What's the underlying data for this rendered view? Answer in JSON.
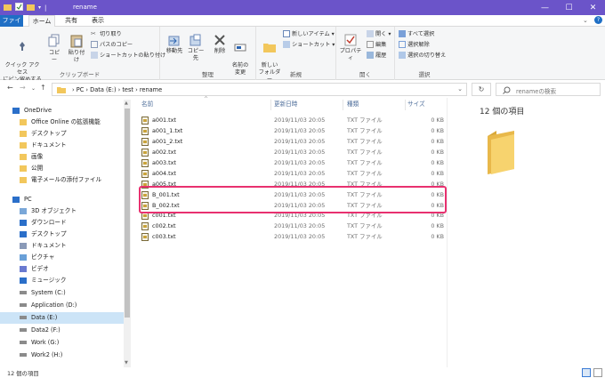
{
  "window": {
    "title": "rename"
  },
  "tabs": [
    "ファイル",
    "ホーム",
    "共有",
    "表示"
  ],
  "ribbon": {
    "clipboard": {
      "pin": "クイック アクセス\nにピン留めする",
      "copy": "コピー",
      "paste": "貼り付け",
      "cut": "切り取り",
      "copy_path": "パスのコピー",
      "paste_shortcut": "ショートカットの貼り付け",
      "label": "クリップボード"
    },
    "organize": {
      "move": "移動先",
      "copy_to": "コピー先",
      "delete": "削除",
      "rename": "名前の\n変更",
      "label": "整理"
    },
    "new": {
      "new_folder": "新しい\nフォルダー",
      "new_item": "新しいアイテム ▾",
      "shortcut": "ショートカット ▾",
      "label": "新規"
    },
    "open": {
      "properties": "プロパティ",
      "open": "開く ▾",
      "edit": "編集",
      "history": "履歴",
      "label": "開く"
    },
    "select": {
      "select_all": "すべて選択",
      "select_none": "選択解除",
      "invert": "選択の切り替え",
      "label": "選択"
    }
  },
  "address": {
    "crumbs": "›   PC   ›   Data (E:)   ›   test   ›   rename",
    "search_placeholder": "renameの検索"
  },
  "nav": {
    "items": [
      {
        "label": "OneDrive",
        "icon": "cloud-icon"
      },
      {
        "label": "Office Online の拡張機能",
        "icon": "folder-icon"
      },
      {
        "label": "デスクトップ",
        "icon": "folder-icon"
      },
      {
        "label": "ドキュメント",
        "icon": "folder-icon"
      },
      {
        "label": "画像",
        "icon": "folder-icon"
      },
      {
        "label": "公開",
        "icon": "folder-icon"
      },
      {
        "label": "電子メールの添付ファイル",
        "icon": "folder-icon"
      },
      {
        "label": "PC",
        "icon": "pc-icon"
      },
      {
        "label": "3D オブジェクト",
        "icon": "cube-icon"
      },
      {
        "label": "ダウンロード",
        "icon": "download-icon"
      },
      {
        "label": "デスクトップ",
        "icon": "desktop-icon"
      },
      {
        "label": "ドキュメント",
        "icon": "document-icon"
      },
      {
        "label": "ピクチャ",
        "icon": "picture-icon"
      },
      {
        "label": "ビデオ",
        "icon": "video-icon"
      },
      {
        "label": "ミュージック",
        "icon": "music-icon"
      },
      {
        "label": "System (C:)",
        "icon": "drive-icon"
      },
      {
        "label": "Application (D:)",
        "icon": "drive-icon"
      },
      {
        "label": "Data (E:)",
        "icon": "drive-icon"
      },
      {
        "label": "Data2 (F:)",
        "icon": "drive-icon"
      },
      {
        "label": "Work (G:)",
        "icon": "drive-icon"
      },
      {
        "label": "Work2 (H:)",
        "icon": "drive-icon"
      }
    ]
  },
  "columns": {
    "name": "名前",
    "date": "更新日時",
    "type": "種類",
    "size": "サイズ"
  },
  "files": [
    {
      "name": "a001.txt",
      "date": "2019/11/03 20:05",
      "type": "TXT ファイル",
      "size": "0 KB"
    },
    {
      "name": "a001_1.txt",
      "date": "2019/11/03 20:05",
      "type": "TXT ファイル",
      "size": "0 KB"
    },
    {
      "name": "a001_2.txt",
      "date": "2019/11/03 20:05",
      "type": "TXT ファイル",
      "size": "0 KB"
    },
    {
      "name": "a002.txt",
      "date": "2019/11/03 20:05",
      "type": "TXT ファイル",
      "size": "0 KB"
    },
    {
      "name": "a003.txt",
      "date": "2019/11/03 20:05",
      "type": "TXT ファイル",
      "size": "0 KB"
    },
    {
      "name": "a004.txt",
      "date": "2019/11/03 20:05",
      "type": "TXT ファイル",
      "size": "0 KB"
    },
    {
      "name": "a005.txt",
      "date": "2019/11/03 20:05",
      "type": "TXT ファイル",
      "size": "0 KB"
    },
    {
      "name": "B_001.txt",
      "date": "2019/11/03 20:05",
      "type": "TXT ファイル",
      "size": "0 KB"
    },
    {
      "name": "B_002.txt",
      "date": "2019/11/03 20:05",
      "type": "TXT ファイル",
      "size": "0 KB"
    },
    {
      "name": "c001.txt",
      "date": "2019/11/03 20:05",
      "type": "TXT ファイル",
      "size": "0 KB"
    },
    {
      "name": "c002.txt",
      "date": "2019/11/03 20:05",
      "type": "TXT ファイル",
      "size": "0 KB"
    },
    {
      "name": "c003.txt",
      "date": "2019/11/03 20:05",
      "type": "TXT ファイル",
      "size": "0 KB"
    }
  ],
  "preview": {
    "count": "12 個の項目"
  },
  "status": {
    "text": "12 個の項目"
  },
  "colors": {
    "titlebar": "#6b54c9",
    "file_tab": "#1f6fc5",
    "highlight": "#e8306f",
    "folder": "#f2c75c"
  }
}
